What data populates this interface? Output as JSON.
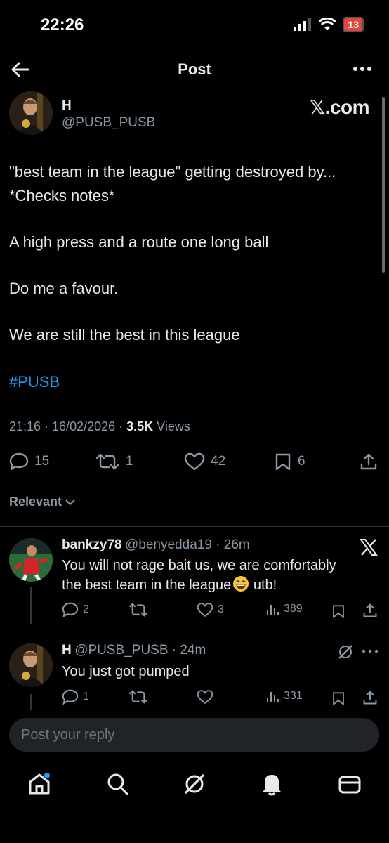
{
  "status_bar": {
    "time": "22:26",
    "battery": "13"
  },
  "header": {
    "title": "Post"
  },
  "post": {
    "author_name": "H",
    "author_handle": "@PUSB_PUSB",
    "watermark": "𝕏.com",
    "lines": [
      "\"best team in the league\" getting destroyed by...",
      "*Checks notes*",
      "A high press and a route one long ball",
      "Do me a favour.",
      "We are still the best in this league"
    ],
    "hashtag": "#PUSB",
    "meta_time": "21:16 · 16/02/2026 · ",
    "views_count": "3.5K",
    "views_label": " Views",
    "stats": {
      "replies": "15",
      "reposts": "1",
      "likes": "42",
      "bookmarks": "6"
    }
  },
  "sort": {
    "label": "Relevant"
  },
  "replies": [
    {
      "name": "bankzy78",
      "handle": "@benyedda19 · 26m",
      "line1": "You will not rage bait us, we are comfortably",
      "line2_a": "the best team in the league",
      "line2_b": " utb!",
      "stats": {
        "replies": "2",
        "likes": "3",
        "views": "389"
      }
    },
    {
      "name": "H",
      "handle": "@PUSB_PUSB · 24m",
      "line1": "You just got pumped",
      "stats": {
        "replies": "1",
        "views": "331"
      }
    }
  ],
  "composer": {
    "placeholder": "Post your reply"
  },
  "colors": {
    "accent": "#1d9bf0",
    "background": "#000000",
    "muted": "#8b98a5"
  }
}
